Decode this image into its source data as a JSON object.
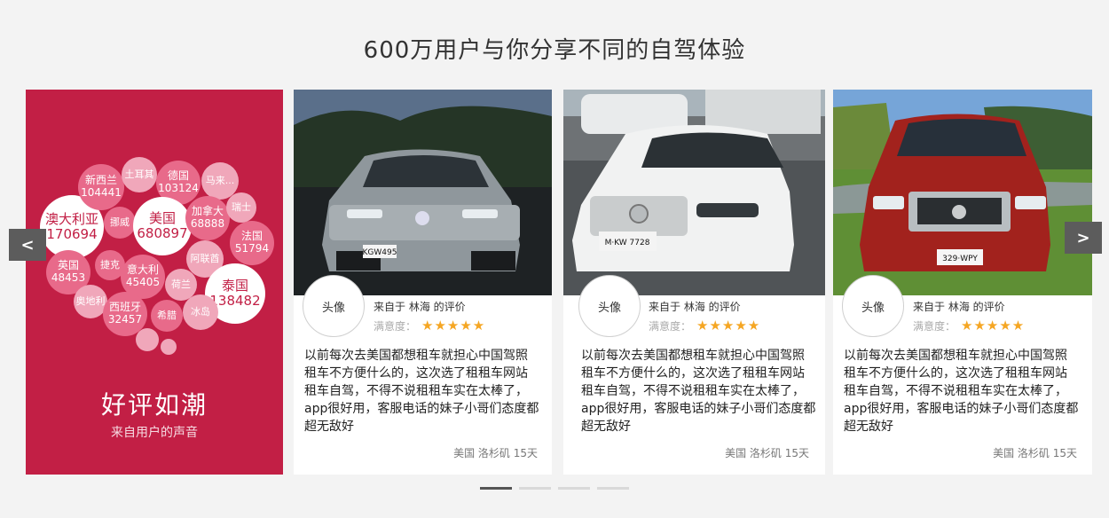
{
  "section_title": "600万用户与你分享不同的自驾体验",
  "promo": {
    "title": "好评如潮",
    "subtitle": "来自用户的声音",
    "bubbles": [
      {
        "name": "澳大利亚",
        "value": "170694"
      },
      {
        "name": "新西兰",
        "value": "104441"
      },
      {
        "name": "土耳其",
        "value": ""
      },
      {
        "name": "德国",
        "value": "103124"
      },
      {
        "name": "马来...",
        "value": ""
      },
      {
        "name": "挪威",
        "value": ""
      },
      {
        "name": "美国",
        "value": "680897"
      },
      {
        "name": "加拿大",
        "value": "68888"
      },
      {
        "name": "瑞士",
        "value": ""
      },
      {
        "name": "法国",
        "value": "51794"
      },
      {
        "name": "英国",
        "value": "48453"
      },
      {
        "name": "捷克",
        "value": ""
      },
      {
        "name": "意大利",
        "value": "45405"
      },
      {
        "name": "阿联酋",
        "value": ""
      },
      {
        "name": "泰国",
        "value": "138482"
      },
      {
        "name": "奥地利",
        "value": ""
      },
      {
        "name": "西班牙",
        "value": "32457"
      },
      {
        "name": "荷兰",
        "value": ""
      },
      {
        "name": "希腊",
        "value": ""
      },
      {
        "name": "冰岛",
        "value": ""
      }
    ]
  },
  "reviews": [
    {
      "avatar": "头像",
      "from": "来自于 林海 的评价",
      "rating_label": "满意度：",
      "stars": "★★★★★",
      "lines": [
        "以前每次去美国都想租车就担心中国驾照",
        "租车不方便什么的，这次选了租租车网站",
        "租车自驾，不得不说租租车实在太棒了，",
        "app很好用，客服电话的妹子小哥们态度都",
        "超无敌好"
      ],
      "location": "美国 洛杉矶 15天",
      "plate": "KGW495"
    },
    {
      "avatar": "头像",
      "from": "来自于 林海 的评价",
      "rating_label": "满意度：",
      "stars": "★★★★★",
      "lines": [
        "以前每次去美国都想租车就担心中国驾照",
        "租车不方便什么的，这次选了租租车网站",
        "租车自驾，不得不说租租车实在太棒了，",
        "app很好用，客服电话的妹子小哥们态度都",
        "超无敌好"
      ],
      "location": "美国 洛杉矶 15天",
      "plate": "M·KW 7728"
    },
    {
      "avatar": "头像",
      "from": "来自于 林海 的评价",
      "rating_label": "满意度：",
      "stars": "★★★★★",
      "lines": [
        "以前每次去美国都想租车就担心中国驾照",
        "租车不方便什么的，这次选了租租车网站",
        "租车自驾，不得不说租租车实在太棒了，",
        "app很好用，客服电话的妹子小哥们态度都",
        "超无敌好"
      ],
      "location": "美国 洛杉矶 15天",
      "plate": "329·WPY"
    }
  ],
  "nav": {
    "prev": "<",
    "next": ">"
  },
  "pagination": {
    "count": 4,
    "active": 1
  },
  "colors": {
    "accent": "#c21f45",
    "star": "#f5a623"
  }
}
